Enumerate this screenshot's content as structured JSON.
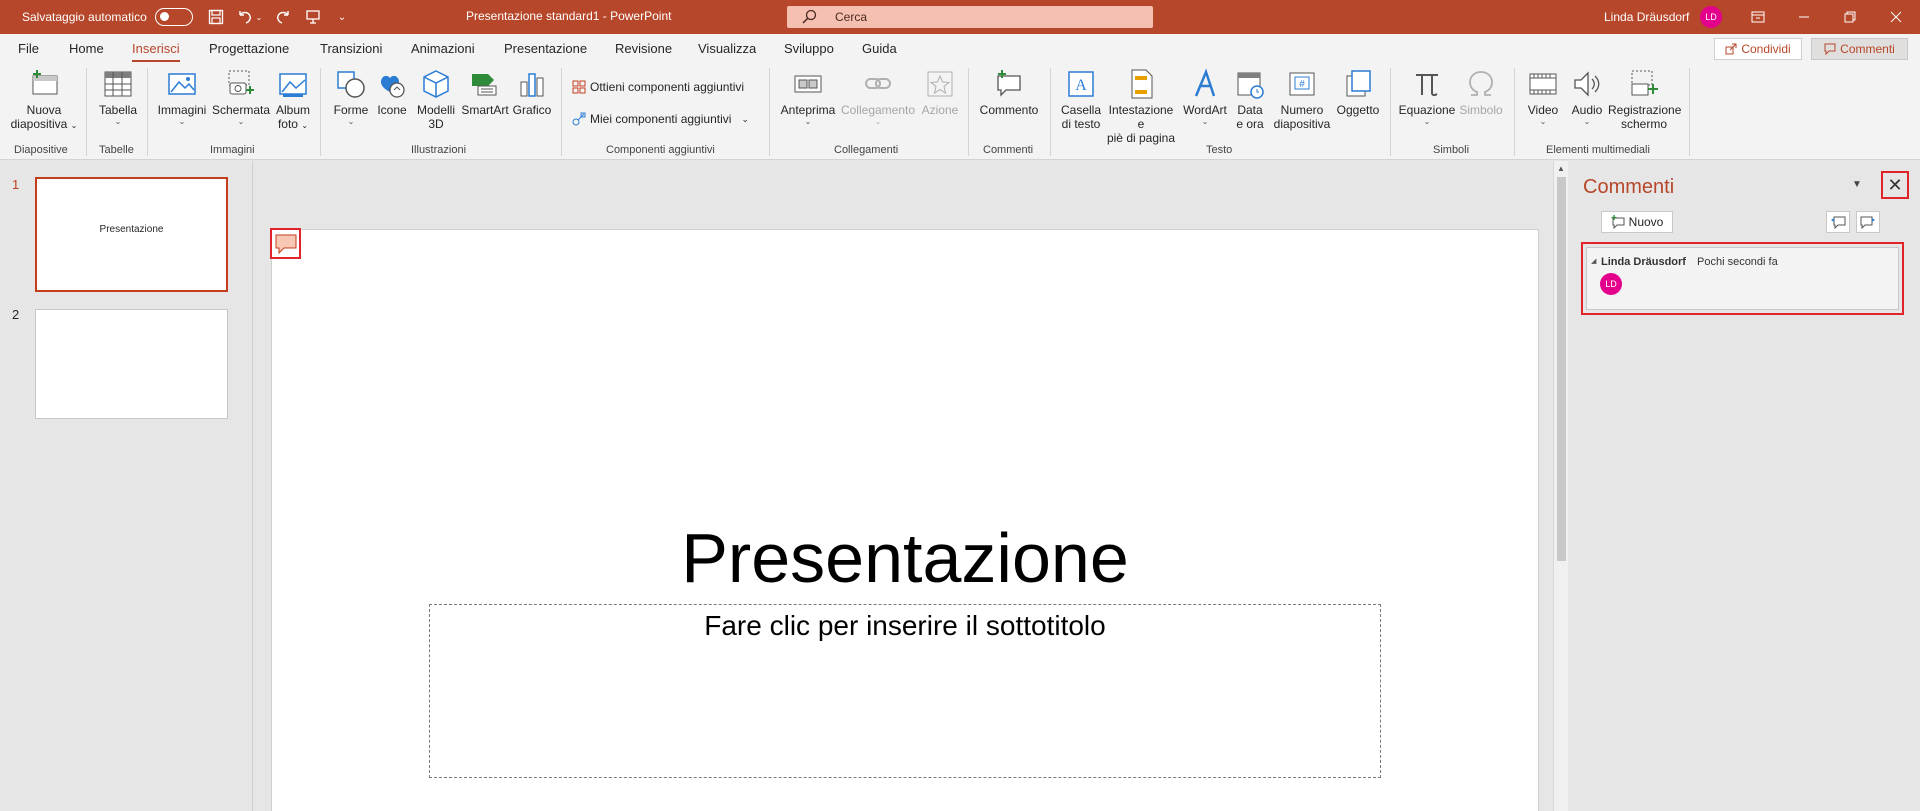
{
  "titlebar": {
    "autosave_label": "Salvataggio automatico",
    "doc_title": "Presentazione standard1  -  PowerPoint",
    "search_placeholder": "Cerca",
    "user_name": "Linda Dräusdorf",
    "user_initials": "LD"
  },
  "menu": {
    "tabs": [
      "File",
      "Home",
      "Inserisci",
      "Progettazione",
      "Transizioni",
      "Animazioni",
      "Presentazione",
      "Revisione",
      "Visualizza",
      "Sviluppo",
      "Guida"
    ],
    "active_tab": "Inserisci",
    "share_label": "Condividi",
    "comments_label": "Commenti"
  },
  "ribbon": {
    "buttons": {
      "nuova_diapositiva": [
        "Nuova",
        "diapositiva"
      ],
      "tabella": "Tabella",
      "immagini": "Immagini",
      "schermata": "Schermata",
      "album_foto": [
        "Album",
        "foto"
      ],
      "forme": "Forme",
      "icone": "Icone",
      "modelli_3d": [
        "Modelli",
        "3D"
      ],
      "smartart": "SmartArt",
      "grafico": "Grafico",
      "ottieni_componenti": "Ottieni componenti aggiuntivi",
      "miei_componenti": "Miei componenti aggiuntivi",
      "anteprima": "Anteprima",
      "collegamento": "Collegamento",
      "azione": "Azione",
      "commento": "Commento",
      "casella_testo": [
        "Casella",
        "di testo"
      ],
      "intestazione": [
        "Intestazione e",
        "piè di pagina"
      ],
      "wordart": "WordArt",
      "data_ora": [
        "Data",
        "e ora"
      ],
      "numero_diapositiva": [
        "Numero",
        "diapositiva"
      ],
      "oggetto": "Oggetto",
      "equazione": "Equazione",
      "simbolo": "Simbolo",
      "video": "Video",
      "audio": "Audio",
      "registrazione": [
        "Registrazione",
        "schermo"
      ]
    },
    "groups": {
      "diapositive": "Diapositive",
      "tabelle": "Tabelle",
      "immagini": "Immagini",
      "illustrazioni": "Illustrazioni",
      "componenti": "Componenti aggiuntivi",
      "collegamenti": "Collegamenti",
      "commenti": "Commenti",
      "testo": "Testo",
      "simboli": "Simboli",
      "multimedia": "Elementi multimediali"
    }
  },
  "thumbnails": [
    {
      "number": "1",
      "text": "Presentazione",
      "selected": true
    },
    {
      "number": "2",
      "text": "",
      "selected": false
    }
  ],
  "slide": {
    "title": "Presentazione",
    "subtitle_placeholder": "Fare clic per inserire il sottotitolo"
  },
  "comments_pane": {
    "title": "Commenti",
    "new_label": "Nuovo",
    "comment": {
      "author": "Linda Dräusdorf",
      "time": "Pochi secondi fa",
      "initials": "LD"
    }
  },
  "colors": {
    "brand": "#b7472a",
    "highlight": "#e0242a",
    "avatar": "#e3008c"
  }
}
